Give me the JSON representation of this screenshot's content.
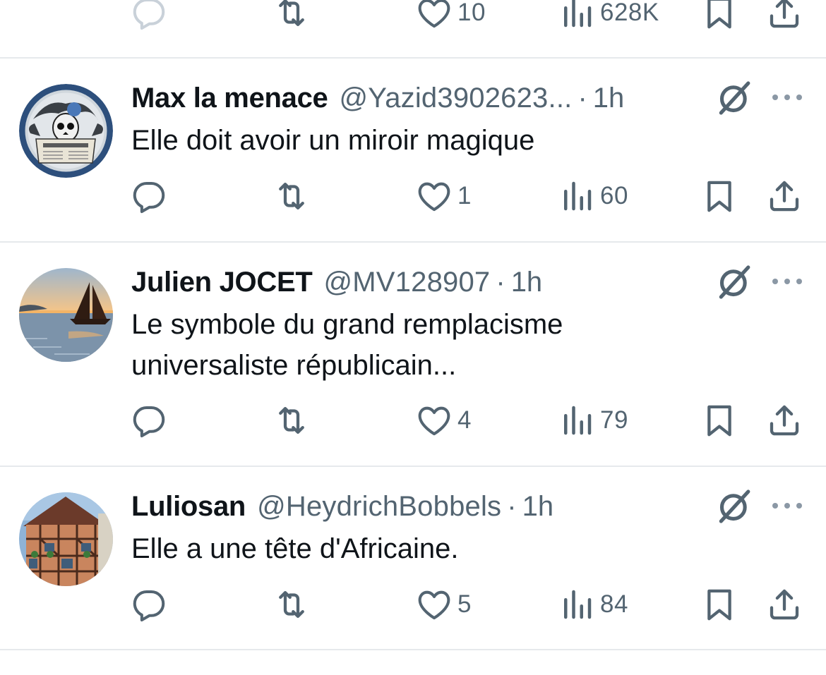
{
  "top_actions": {
    "reply": "",
    "retweet": "",
    "like": "10",
    "views": "628K"
  },
  "tweets": [
    {
      "display_name": "Max la menace",
      "handle": "@Yazid3902623...",
      "separator": "·",
      "time": "1h",
      "text": "Elle doit avoir un miroir magique",
      "avatar": "skull-newspaper-avatar",
      "actions": {
        "reply": "",
        "retweet": "",
        "like": "1",
        "views": "60"
      }
    },
    {
      "display_name": "Julien JOCET",
      "handle": "@MV128907",
      "separator": "·",
      "time": "1h",
      "text": "Le symbole du grand remplacisme universaliste républicain...",
      "avatar": "sailboat-sunset-avatar",
      "actions": {
        "reply": "",
        "retweet": "",
        "like": "4",
        "views": "79"
      }
    },
    {
      "display_name": "Luliosan",
      "handle": "@HeydrichBobbels",
      "separator": "·",
      "time": "1h",
      "text": "Elle a une tête d'Africaine.",
      "avatar": "half-timbered-house-avatar",
      "actions": {
        "reply": "",
        "retweet": "",
        "like": "5",
        "views": "84"
      }
    }
  ],
  "icons": {
    "reply": "reply-icon",
    "retweet": "retweet-icon",
    "like": "heart-icon",
    "views": "views-bar-chart-icon",
    "bookmark": "bookmark-icon",
    "share": "share-icon",
    "grok": "grok-icon",
    "more": "more-dots-icon"
  },
  "colors": {
    "text_primary": "#0f1419",
    "text_secondary": "#536471",
    "divider": "#e6e9ec",
    "background": "#ffffff"
  }
}
